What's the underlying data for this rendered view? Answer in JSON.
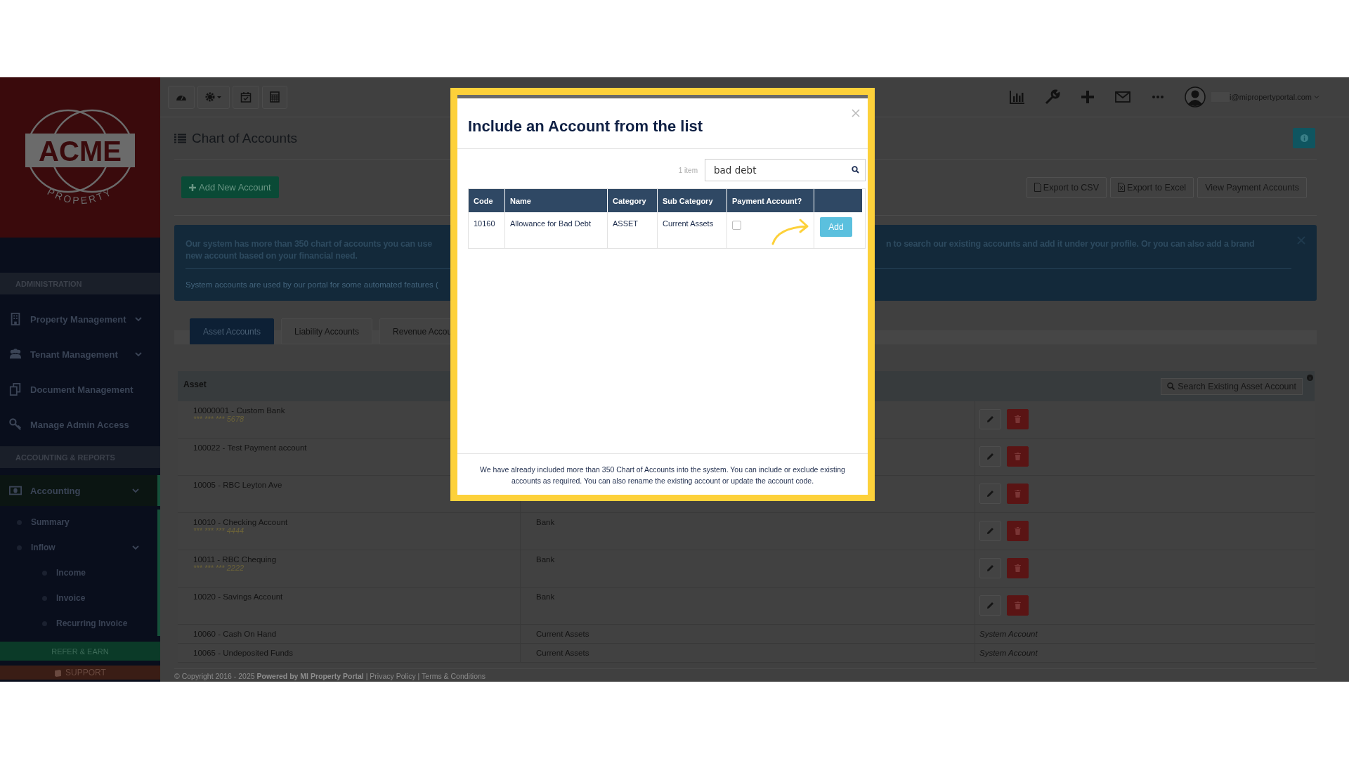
{
  "sidebar": {
    "logo": {
      "wordmark": "ACME",
      "tagline": "PROPERTY"
    },
    "sections": [
      {
        "title": "ADMINISTRATION",
        "items": [
          {
            "label": "Property Management",
            "kind": "group",
            "selected": false
          },
          {
            "label": "Tenant Management",
            "kind": "group",
            "selected": false
          },
          {
            "label": "Document Management",
            "kind": "link",
            "selected": false
          },
          {
            "label": "Manage Admin Access",
            "kind": "link",
            "selected": false
          }
        ]
      },
      {
        "title": "ACCOUNTING & REPORTS",
        "items": [
          {
            "label": "Accounting",
            "kind": "group",
            "selected": true,
            "children": [
              {
                "label": "Summary",
                "selected": false
              },
              {
                "label": "Inflow",
                "selected": false,
                "children": [
                  {
                    "label": "Income",
                    "selected": false
                  },
                  {
                    "label": "Invoice",
                    "selected": false
                  },
                  {
                    "label": "Recurring Invoice",
                    "selected": false
                  }
                ]
              }
            ]
          }
        ]
      }
    ],
    "buttons": [
      {
        "label": "REFER & EARN",
        "kind": "refer"
      },
      {
        "label": "SUPPORT",
        "kind": "support"
      }
    ]
  },
  "topbar": {
    "user_email": "i@mipropertyportal.com"
  },
  "page": {
    "title": "Chart of Accounts",
    "add_button": "Add New Account",
    "export_buttons": [
      "Export to CSV",
      "Export to Excel",
      "View Payment Accounts"
    ]
  },
  "alert": {
    "line1_left": "Our system has more than 350 chart of accounts you can use",
    "line1_right": "n to search our existing accounts and add it under your profile. Or you can also add a brand",
    "line2": "new account based on your financial need.",
    "note": "System accounts are used by our portal for some automated features ("
  },
  "tabs": [
    {
      "label": "Asset Accounts",
      "selected": true
    },
    {
      "label": "Liability Accounts",
      "selected": false
    },
    {
      "label": "Revenue Accou",
      "selected": false
    }
  ],
  "table": {
    "column": "Asset",
    "search_button": "Search Existing Asset Account",
    "rows": [
      {
        "name": "10000001 - Custom Bank",
        "masked": "*** *** ***",
        "last4": "5678",
        "kind": "editable"
      },
      {
        "name": "100022 - Test Payment account",
        "kind": "editable"
      },
      {
        "name": "10005 - RBC Leyton Ave",
        "kind": "editable"
      },
      {
        "name": "10010 - Checking Account",
        "masked": "*** *** ***",
        "last4": "4444",
        "category": "Bank",
        "kind": "editable"
      },
      {
        "name": "10011 - RBC Chequing",
        "masked": "*** *** ***",
        "last4": "2222",
        "category": "Bank",
        "kind": "editable"
      },
      {
        "name": "10020 - Savings Account",
        "category": "Bank",
        "kind": "editable"
      },
      {
        "name": "10060 - Cash On Hand",
        "category": "Current Assets",
        "kind": "system",
        "status": "System Account"
      },
      {
        "name": "10065 - Undeposited Funds",
        "category": "Current Assets",
        "kind": "system",
        "status": "System Account"
      }
    ]
  },
  "footer": "© Copyright 2016 - 2025 **Powered by MI Property Portal** | Privacy Policy | Terms & Conditions",
  "modal": {
    "title": "Include an Account from the list",
    "count": "1 item",
    "search": {
      "value": "bad debt"
    },
    "columns": [
      "Code",
      "Name",
      "Category",
      "Sub Category",
      "Payment Account?"
    ],
    "rows": [
      {
        "code": "10160",
        "name": "Allowance for Bad Debt",
        "category": "ASSET",
        "sub_category": "Current Assets",
        "payment_account": false,
        "action": "Add"
      }
    ],
    "note": "We have already included more than 350 Chart of Accounts into the system. You can include or exclude existing accounts as required. You can also rename the existing account or update the account code."
  }
}
